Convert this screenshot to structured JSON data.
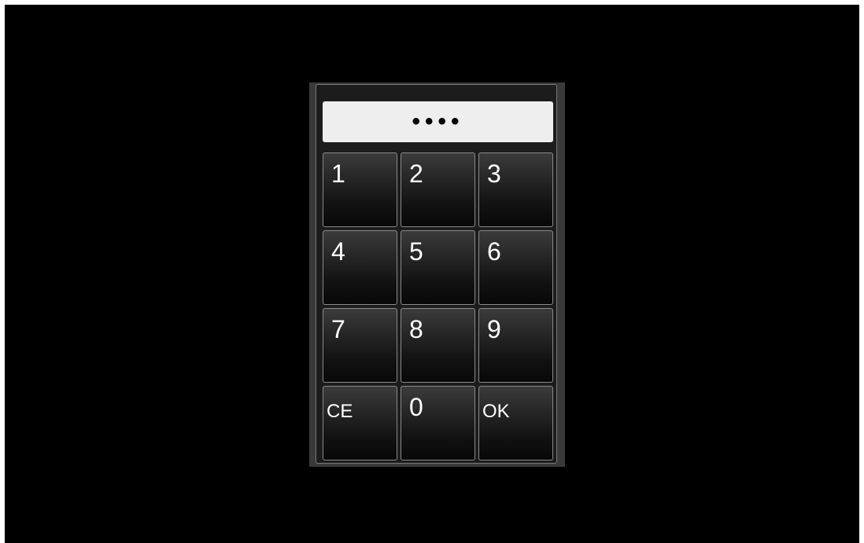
{
  "pin_display": {
    "masked_value": "••••"
  },
  "keys": {
    "k1": "1",
    "k2": "2",
    "k3": "3",
    "k4": "4",
    "k5": "5",
    "k6": "6",
    "k7": "7",
    "k8": "8",
    "k9": "9",
    "clear": "CE",
    "k0": "0",
    "ok": "OK"
  },
  "colors": {
    "background": "#000000",
    "panel": "#1c1c1c",
    "display": "#eeeeee",
    "key_text": "#ffffff"
  }
}
